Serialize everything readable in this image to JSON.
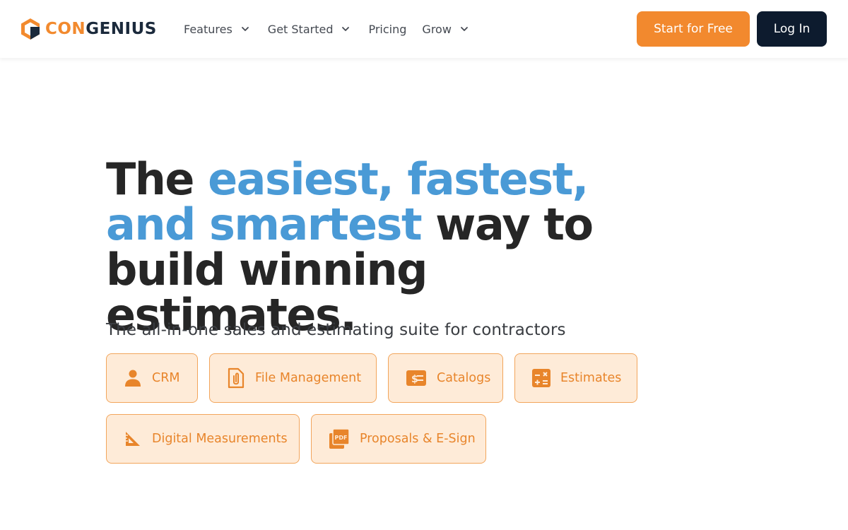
{
  "colors": {
    "brand_orange": "#f2892e",
    "brand_navy": "#0d1b2e",
    "accent_blue": "#4a9ad6",
    "chip_bg": "#feebd8",
    "chip_border": "#f2a55b"
  },
  "header": {
    "logo": {
      "prefix": "CON",
      "suffix": "GENIUS",
      "icon": "congenius-logo-icon"
    },
    "nav": [
      {
        "label": "Features",
        "has_dropdown": true
      },
      {
        "label": "Get Started",
        "has_dropdown": true
      },
      {
        "label": "Pricing",
        "has_dropdown": false
      },
      {
        "label": "Grow",
        "has_dropdown": true
      }
    ],
    "start_label": "Start for Free",
    "login_label": "Log In"
  },
  "hero": {
    "title_part1": "The ",
    "title_accent": "easiest, fastest, and smartest",
    "title_part2": " way to build winning estimates.",
    "subtitle": "The all-in-one sales and estimating suite for contractors"
  },
  "features": [
    {
      "label": "CRM",
      "icon": "person-icon"
    },
    {
      "label": "File Management",
      "icon": "file-attachment-icon"
    },
    {
      "label": "Catalogs",
      "icon": "price-tag-icon"
    },
    {
      "label": "Estimates",
      "icon": "calculator-icon"
    },
    {
      "label": "Digital Measurements",
      "icon": "set-square-icon"
    },
    {
      "label": "Proposals & E-Sign",
      "icon": "pdf-files-icon"
    }
  ]
}
